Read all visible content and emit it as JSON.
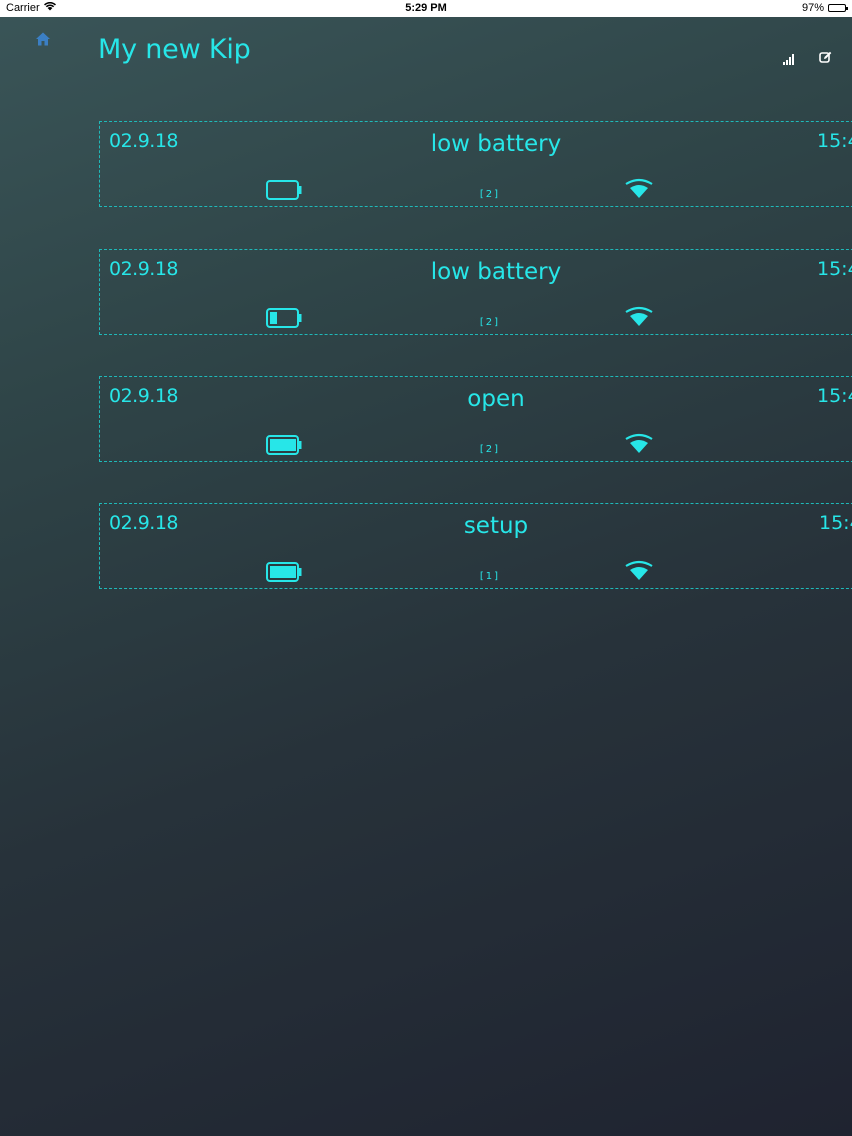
{
  "status_bar": {
    "carrier": "Carrier",
    "time": "5:29 PM",
    "battery": "97%"
  },
  "header": {
    "title": "My new Kip",
    "icons": [
      "home-icon",
      "signal-bars-icon",
      "edit-icon"
    ]
  },
  "colors": {
    "accent": "#27e6e8",
    "home_icon": "#3b7fc4",
    "card_border": "#1fb9b9"
  },
  "events": [
    {
      "date": "02.9.18",
      "status": "low battery",
      "time": "15:4",
      "count": "[2]",
      "battery_level": 0.0
    },
    {
      "date": "02.9.18",
      "status": "low battery",
      "time": "15:4",
      "count": "[2]",
      "battery_level": 0.25
    },
    {
      "date": "02.9.18",
      "status": "open",
      "time": "15:4",
      "count": "[2]",
      "battery_level": 1.0
    },
    {
      "date": "02.9.18",
      "status": "setup",
      "time": "15:4",
      "count": "[1]",
      "battery_level": 1.0
    }
  ]
}
